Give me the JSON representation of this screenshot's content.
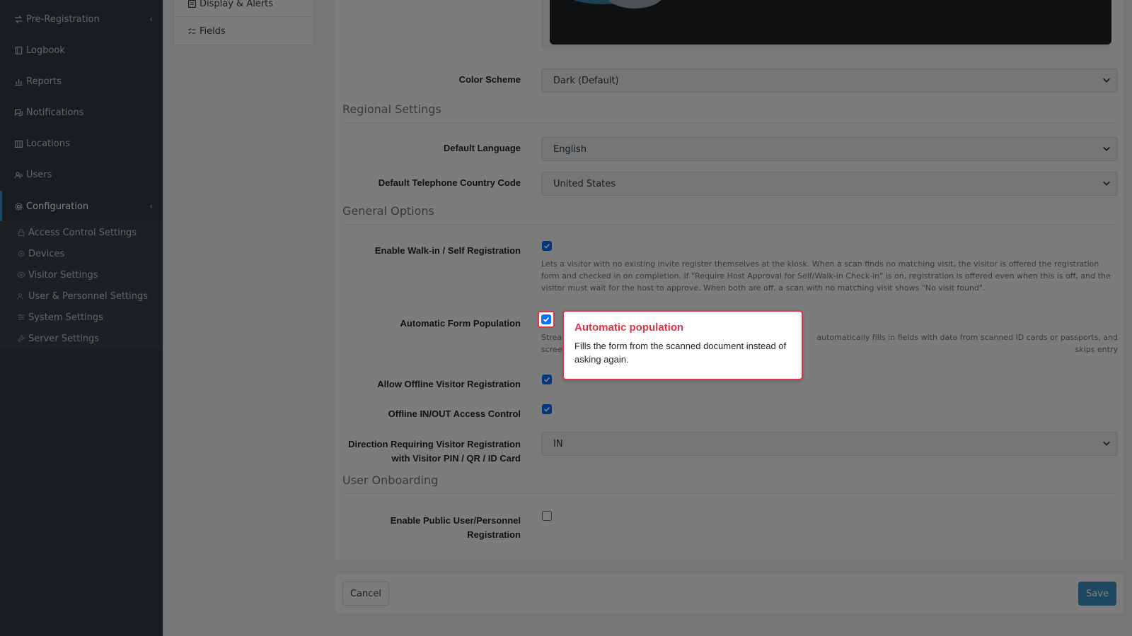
{
  "sidebar": {
    "items": [
      {
        "label": "Pre-Registration",
        "icon": "swap-arrows-icon"
      },
      {
        "label": "Logbook",
        "icon": "book-icon"
      },
      {
        "label": "Reports",
        "icon": "chart-icon"
      },
      {
        "label": "Notifications",
        "icon": "chat-icon"
      },
      {
        "label": "Locations",
        "icon": "building-icon"
      },
      {
        "label": "Users",
        "icon": "users-icon"
      },
      {
        "label": "Configuration",
        "icon": "gear-icon"
      }
    ],
    "sub_items": [
      {
        "label": "Access Control Settings",
        "icon": "lock-icon"
      },
      {
        "label": "Devices",
        "icon": "devices-icon"
      },
      {
        "label": "Visitor Settings",
        "icon": "eye-icon"
      },
      {
        "label": "User & Personnel Settings",
        "icon": "users-icon"
      },
      {
        "label": "System Settings",
        "icon": "sliders-icon"
      },
      {
        "label": "Server Settings",
        "icon": "wrench-icon"
      }
    ]
  },
  "secondary_menu": {
    "items": [
      {
        "label": "Display & Alerts",
        "icon": "display-icon"
      },
      {
        "label": "Fields",
        "icon": "checklist-icon"
      }
    ]
  },
  "form": {
    "color_scheme": {
      "label": "Color Scheme",
      "value": "Dark (Default)"
    },
    "regional_heading": "Regional Settings",
    "default_language": {
      "label": "Default Language",
      "value": "English"
    },
    "country_code": {
      "label": "Default Telephone Country Code",
      "value": "United States"
    },
    "general_heading": "General Options",
    "walkin": {
      "label": "Enable Walk-in / Self Registration",
      "checked": true,
      "help": "Lets a visitor with no existing invite register themselves at the kiosk. When a scan finds no matching visit, the visitor is offered the registration form and checked in on completion. If \"Require Host Approval for Self/Walk-in Check-in\" is on, registration is offered even when this is off, and the visitor must wait for the host to approve. When both are off, a scan with no matching visit shows \"No visit found\"."
    },
    "auto_form": {
      "label": "Automatic Form Population",
      "checked": true,
      "help_left": "Strea",
      "help_left2": "scree",
      "help_right": "automatically fills in fields with data from scanned ID cards or passports, and skips entry"
    },
    "offline_registration": {
      "label": "Allow Offline Visitor Registration",
      "checked": true
    },
    "offline_access": {
      "label": "Offline IN/OUT Access Control",
      "checked": true
    },
    "direction": {
      "label_line1": "Direction Requiring Visitor Registration",
      "label_line2": "with Visitor PIN / QR / ID Card",
      "value": "IN"
    },
    "onboarding_heading": "User Onboarding",
    "public_registration": {
      "label_line1": "Enable Public User/Personnel",
      "label_line2": "Registration",
      "checked": false
    }
  },
  "tooltip": {
    "title": "Automatic population",
    "body": "Fills the form from the scanned document instead of asking again."
  },
  "footer": {
    "cancel_label": "Cancel",
    "save_label": "Save"
  },
  "colors": {
    "accent": "#3c8dbc",
    "highlight": "#dc3545",
    "checkbox": "#0d6efd",
    "sidebar": "#343a40"
  }
}
